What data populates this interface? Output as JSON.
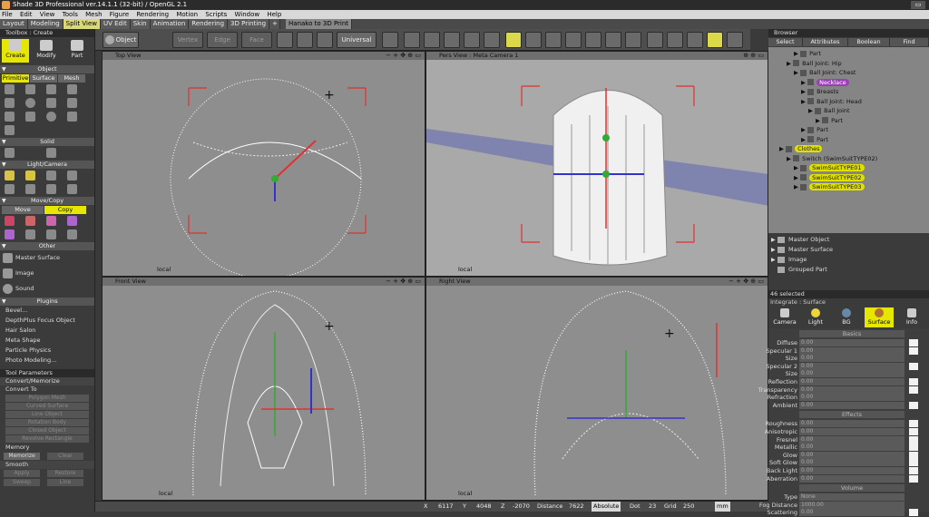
{
  "window": {
    "title": "Shade 3D Professional ver.14.1.1 (32-bit) / OpenGL 2.1"
  },
  "menu": [
    "File",
    "Edit",
    "View",
    "Tools",
    "Mesh",
    "Figure",
    "Rendering",
    "Motion",
    "Scripts",
    "Window",
    "Help"
  ],
  "tabs": [
    "Layout",
    "Modeling",
    "Split View",
    "UV Edit",
    "Skin",
    "Animation",
    "Rendering",
    "3D Printing",
    "Hanako to 3D Print"
  ],
  "active_tab": "Split View",
  "toolbar": {
    "object": "Object",
    "vertex": "Vertex",
    "edge": "Edge",
    "face": "Face",
    "universal": "Universal"
  },
  "toolbox": {
    "title": "Toolbox : Create",
    "modes": [
      "Create",
      "Modify",
      "Part"
    ],
    "section_object": "Object",
    "object_tabs": [
      "Primitive",
      "Surface",
      "Mesh"
    ],
    "section_solid": "Solid",
    "section_light": "Light/Camera",
    "section_move": "Move/Copy",
    "move_tabs": [
      "Move",
      "Copy"
    ],
    "section_other": "Other",
    "other_items": [
      "Master Surface",
      "Image",
      "Sound"
    ],
    "section_plugins": "Plugins",
    "plugins": [
      "Bevel...",
      "DepthPlus Focus Object",
      "Hair Salon",
      "Meta Shape",
      "Particle Physics",
      "Photo Modeling..."
    ]
  },
  "tool_params": {
    "title": "Tool Parameters",
    "section": "Convert/Memorize",
    "convert_to": "Convert To",
    "buttons": [
      "Polygon Mesh",
      "Curved Surface",
      "Line Object",
      "Rotation Body",
      "Closed Object",
      "Revolve Rectangle"
    ],
    "memory": "Memory",
    "memorize": "Memorize",
    "clear": "Clear",
    "smooth": "Smooth",
    "smooth_buttons": [
      "Apply",
      "Restore",
      "Sweep",
      "Line"
    ]
  },
  "viewports": {
    "top": "Top View",
    "pers": "Pers View : Meta Camera 1",
    "front": "Front View",
    "right": "Right View",
    "local": "local"
  },
  "browser": {
    "title": "Browser",
    "tabs": [
      "Select",
      "Attributes",
      "Boolean",
      "Find"
    ],
    "tree": [
      {
        "label": "Part",
        "indent": 3,
        "hl": ""
      },
      {
        "label": "Ball Joint: Hip",
        "indent": 2,
        "hl": ""
      },
      {
        "label": "Ball Joint: Chest",
        "indent": 3,
        "hl": ""
      },
      {
        "label": "Necklace",
        "indent": 4,
        "hl": "purple"
      },
      {
        "label": "Breasts",
        "indent": 4,
        "hl": ""
      },
      {
        "label": "Ball Joint: Head",
        "indent": 4,
        "hl": ""
      },
      {
        "label": "Ball Joint",
        "indent": 5,
        "hl": ""
      },
      {
        "label": "Part",
        "indent": 6,
        "hl": ""
      },
      {
        "label": "Part",
        "indent": 4,
        "hl": ""
      },
      {
        "label": "Part",
        "indent": 4,
        "hl": ""
      },
      {
        "label": "Clothes",
        "indent": 1,
        "hl": "yellow"
      },
      {
        "label": "Switch (SwimSuitTYPE02)",
        "indent": 2,
        "hl": ""
      },
      {
        "label": "SwimSuitTYPE01",
        "indent": 3,
        "hl": "yellow"
      },
      {
        "label": "SwimSuitTYPE02",
        "indent": 3,
        "hl": "yellow"
      },
      {
        "label": "SwimSuitTYPE03",
        "indent": 3,
        "hl": "yellow"
      }
    ],
    "masters": [
      "Master Object",
      "Master Surface",
      "Image",
      "Grouped Part"
    ]
  },
  "attributes": {
    "selected": "46 selected",
    "sub": "Integrate : Surface",
    "tabs": [
      "Camera",
      "Light",
      "BG",
      "Surface",
      "Info"
    ],
    "active_tab": "Surface",
    "group_basics": "Basics",
    "group_effects": "Effects",
    "group_volume": "Volume",
    "basics": [
      "Diffuse",
      "Specular 1",
      "Size",
      "Specular 2",
      "Size",
      "Reflection",
      "Transparency",
      "Refraction",
      "Ambient"
    ],
    "effects": [
      "Roughness",
      "Anisotropic",
      "Fresnel",
      "Metallic",
      "Glow",
      "Soft Glow",
      "Back Light",
      "Aberration"
    ],
    "volume": [
      "Type",
      "Fog Distance",
      "Scattering"
    ],
    "value": "0.00",
    "type_value": "None",
    "fog_value": "1000.00"
  },
  "status": {
    "x_label": "X",
    "x": "6117",
    "y_label": "Y",
    "y": "4048",
    "z_label": "Z",
    "z": "-2070",
    "distance_label": "Distance",
    "distance": "7622",
    "mode": "Absolute",
    "dot_label": "Dot",
    "dot": "23",
    "grid_label": "Grid",
    "grid": "250",
    "unit": "mm"
  },
  "colors": {
    "accent_yellow": "#e6e600",
    "viewport_gray": "#8e8e8e",
    "purple_highlight": "#9a3fb8"
  }
}
